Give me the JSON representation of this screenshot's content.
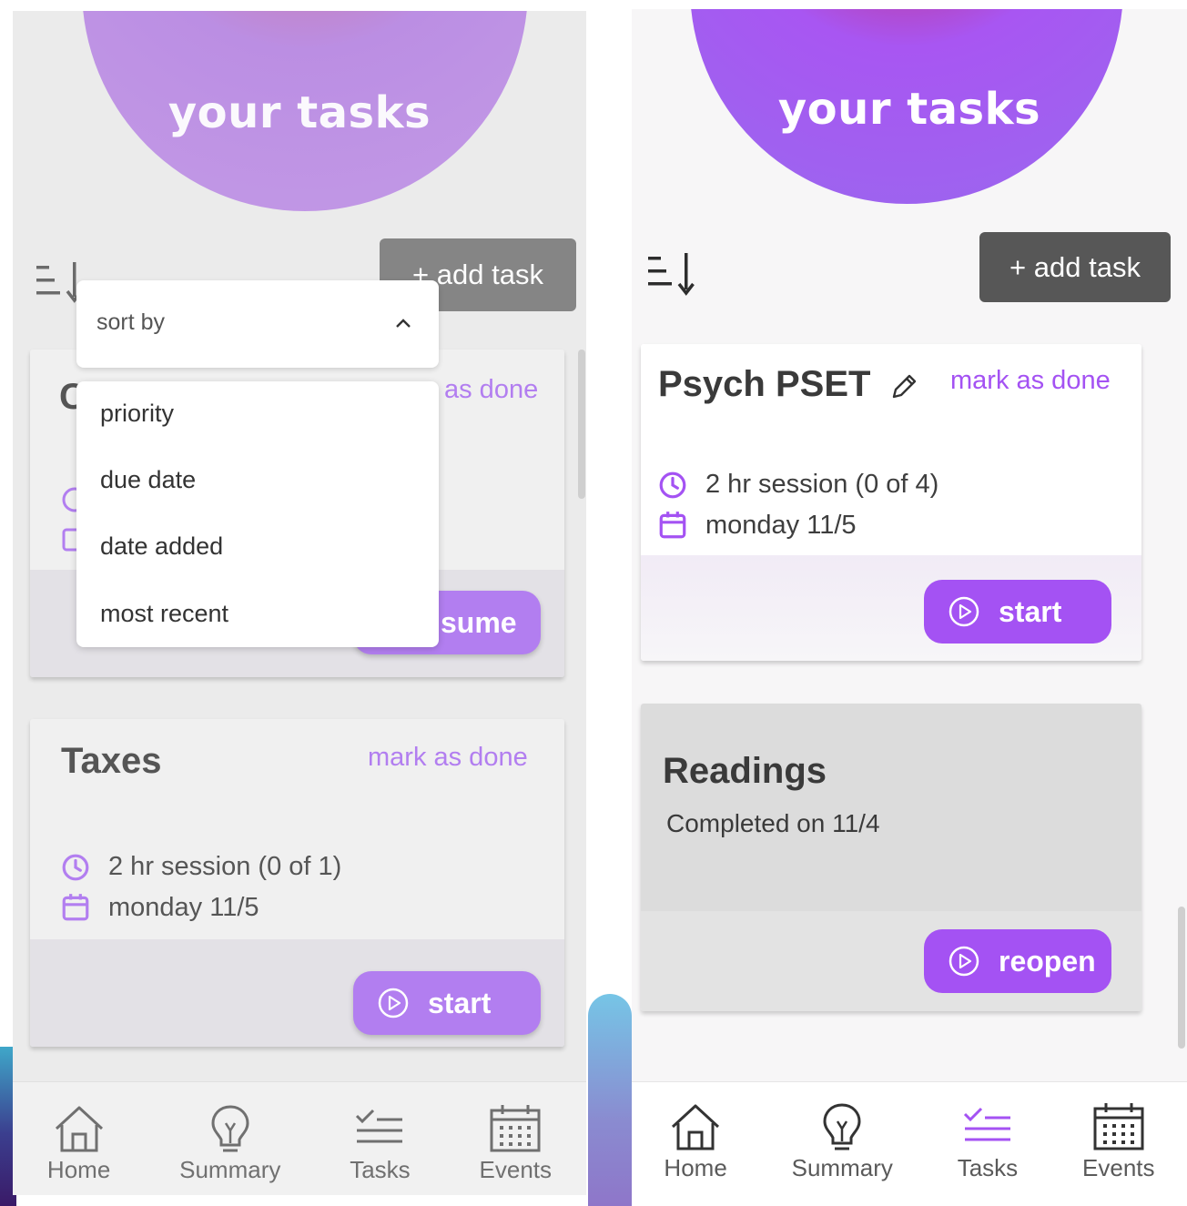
{
  "left_screen": {
    "header_title": "your tasks",
    "add_task_label": "+ add task",
    "sort_dropdown": {
      "label": "sort by",
      "options": [
        "priority",
        "due date",
        "date added",
        "most recent"
      ]
    },
    "partial_card": {
      "title_fragment": "C",
      "mark_done_fragment": "as done",
      "action_fragment": "sume"
    },
    "task_card": {
      "title": "Taxes",
      "mark_done": "mark as done",
      "session": "2 hr session (0 of 1)",
      "date": "monday 11/5",
      "action": "start"
    },
    "nav": [
      {
        "label": "Home",
        "icon": "home-icon",
        "active": false
      },
      {
        "label": "Summary",
        "icon": "lightbulb-icon",
        "active": false
      },
      {
        "label": "Tasks",
        "icon": "tasks-icon",
        "active": false
      },
      {
        "label": "Events",
        "icon": "calendar-icon",
        "active": false
      }
    ]
  },
  "right_screen": {
    "header_title": "your tasks",
    "add_task_label": "+ add task",
    "task_card": {
      "title": "Psych PSET",
      "mark_done": "mark as done",
      "session": "2 hr session (0 of 4)",
      "date": "monday 11/5",
      "action": "start"
    },
    "completed_card": {
      "title": "Readings",
      "subtitle": "Completed on 11/4",
      "action": "reopen"
    },
    "nav": [
      {
        "label": "Home",
        "icon": "home-icon",
        "active": false
      },
      {
        "label": "Summary",
        "icon": "lightbulb-icon",
        "active": false
      },
      {
        "label": "Tasks",
        "icon": "tasks-icon",
        "active": true
      },
      {
        "label": "Events",
        "icon": "calendar-icon",
        "active": false
      }
    ]
  },
  "colors": {
    "accent": "#a452f3",
    "accent_button": "#a452f3",
    "accent_button_faded": "#b27ef0",
    "dark_button": "#575757",
    "nav_active": "#a452f3",
    "nav_inactive": "#5a5a5a"
  }
}
